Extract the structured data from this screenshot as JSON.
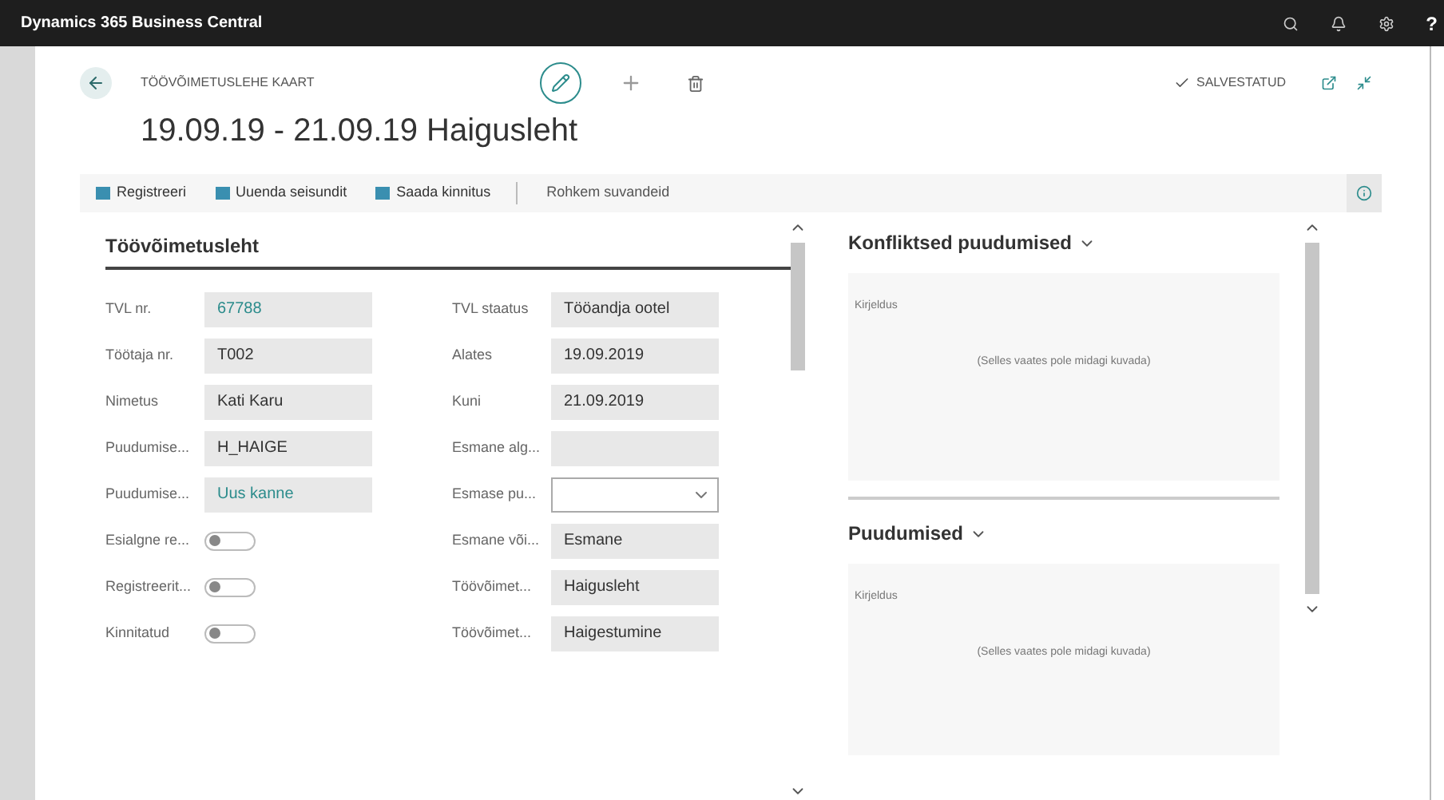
{
  "app_bar": {
    "title": "Dynamics 365 Business Central",
    "help": "?"
  },
  "page": {
    "caption": "TÖÖVÕIMETUSLEHE KAART",
    "title": "19.09.19 - 21.09.19 Haigusleht",
    "save_status": "SALVESTATUD"
  },
  "actions": [
    {
      "label": "Registreeri"
    },
    {
      "label": "Uuenda seisundit"
    },
    {
      "label": "Saada kinnitus"
    }
  ],
  "more_actions": "Rohkem suvandeid",
  "section": {
    "title": "Töövõimetusleht",
    "left_fields": [
      {
        "label": "TVL nr.",
        "kind": "link",
        "value": "67788"
      },
      {
        "label": "Töötaja nr.",
        "kind": "text",
        "value": "T002"
      },
      {
        "label": "Nimetus",
        "kind": "text",
        "value": "Kati Karu"
      },
      {
        "label": "Puudumise...",
        "kind": "text",
        "value": "H_HAIGE"
      },
      {
        "label": "Puudumise...",
        "kind": "link",
        "value": "Uus kanne"
      },
      {
        "label": "Esialgne re...",
        "kind": "toggle",
        "on": false
      },
      {
        "label": "Registreerit...",
        "kind": "toggle",
        "on": false
      },
      {
        "label": "Kinnitatud",
        "kind": "toggle",
        "on": false
      }
    ],
    "right_fields": [
      {
        "label": "TVL staatus",
        "kind": "text",
        "value": "Tööandja ootel"
      },
      {
        "label": "Alates",
        "kind": "text",
        "value": "19.09.2019"
      },
      {
        "label": "Kuni",
        "kind": "text",
        "value": "21.09.2019"
      },
      {
        "label": "Esmane alg...",
        "kind": "text"
      },
      {
        "label": "Esmase pu...",
        "kind": "select"
      },
      {
        "label": "Esmane või...",
        "kind": "text",
        "value": "Esmane"
      },
      {
        "label": "Töövõimet...",
        "kind": "text",
        "value": "Haigusleht"
      },
      {
        "label": "Töövõimet...",
        "kind": "text",
        "value": "Haigestumine"
      }
    ]
  },
  "factboxes": [
    {
      "title": "Konfliktsed puudumised",
      "column": "Kirjeldus",
      "empty_text": "(Selles vaates pole midagi kuvada)"
    },
    {
      "title": "Puudumised",
      "column": "Kirjeldus",
      "empty_text": "(Selles vaates pole midagi kuvada)"
    }
  ]
}
